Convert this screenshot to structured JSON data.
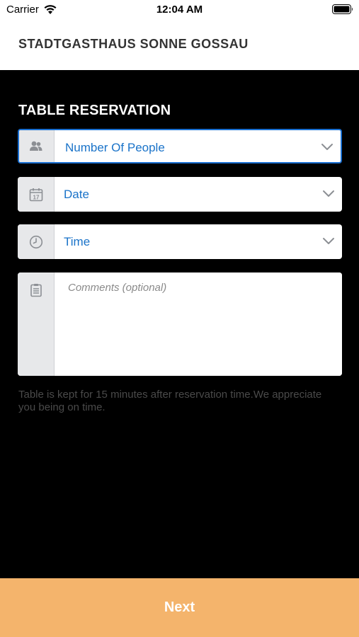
{
  "status_bar": {
    "carrier": "Carrier",
    "time": "12:04 AM"
  },
  "nav": {
    "title": "STADTGASTHAUS SONNE GOSSAU"
  },
  "reservation": {
    "title": "TABLE RESERVATION",
    "fields": [
      {
        "icon": "people-icon",
        "label": "Number Of People",
        "focused": true
      },
      {
        "icon": "calendar-icon",
        "label": "Date",
        "calendar_day": "17"
      },
      {
        "icon": "clock-icon",
        "label": "Time"
      }
    ],
    "comments": {
      "icon": "notepad-icon",
      "placeholder": "Comments (optional)"
    },
    "note": "Table is kept for 15 minutes after reservation time.We appreciate you being on time."
  },
  "footer": {
    "next_label": "Next"
  },
  "colors": {
    "accent_button": "#f4b46c",
    "field_text": "#1a73c9",
    "focus_border": "#1a6fd1",
    "background": "#000000"
  }
}
